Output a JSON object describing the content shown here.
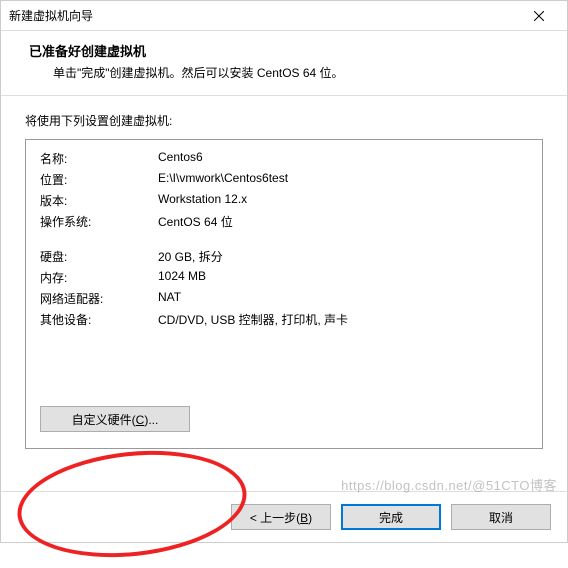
{
  "window": {
    "title": "新建虚拟机向导"
  },
  "header": {
    "title": "已准备好创建虚拟机",
    "subtitle": "单击\"完成\"创建虚拟机。然后可以安装 CentOS 64 位。"
  },
  "lead": "将使用下列设置创建虚拟机:",
  "rows": [
    {
      "label": "名称:",
      "value": "Centos6"
    },
    {
      "label": "位置:",
      "value": "E:\\I\\vmwork\\Centos6test"
    },
    {
      "label": "版本:",
      "value": "Workstation 12.x"
    },
    {
      "label": "操作系统:",
      "value": "CentOS 64 位"
    }
  ],
  "rows2": [
    {
      "label": "硬盘:",
      "value": "20 GB, 拆分"
    },
    {
      "label": "内存:",
      "value": "1024 MB"
    },
    {
      "label": "网络适配器:",
      "value": "NAT"
    },
    {
      "label": "其他设备:",
      "value": "CD/DVD, USB 控制器, 打印机, 声卡"
    }
  ],
  "buttons": {
    "customize_pre": "自定义硬件(",
    "customize_key": "C",
    "customize_post": ")...",
    "back_pre": "< 上一步(",
    "back_key": "B",
    "back_post": ")",
    "finish": "完成",
    "cancel": "取消"
  },
  "watermark": "https://blog.csdn.net/@51CTO博客"
}
